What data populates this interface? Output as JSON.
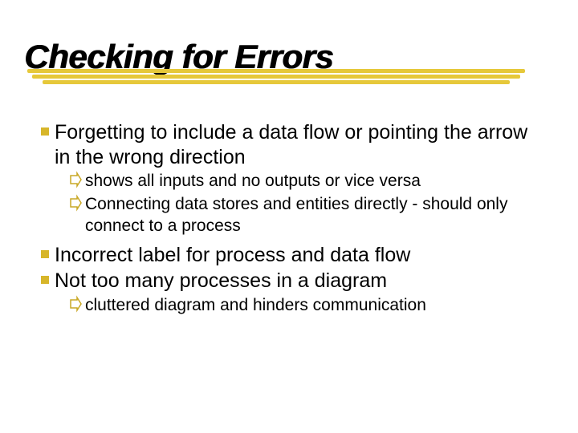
{
  "title": "Checking for Errors",
  "bullets": {
    "b1": "Forgetting to include a data flow or pointing the arrow in the wrong direction",
    "b1a": "shows all inputs and no outputs or vice versa",
    "b1b": "Connecting data stores and entities directly - should only connect to a process",
    "b2": "Incorrect label for process and data flow",
    "b3": "Not too many processes in a diagram",
    "b3a": "cluttered diagram and hinders communication"
  }
}
